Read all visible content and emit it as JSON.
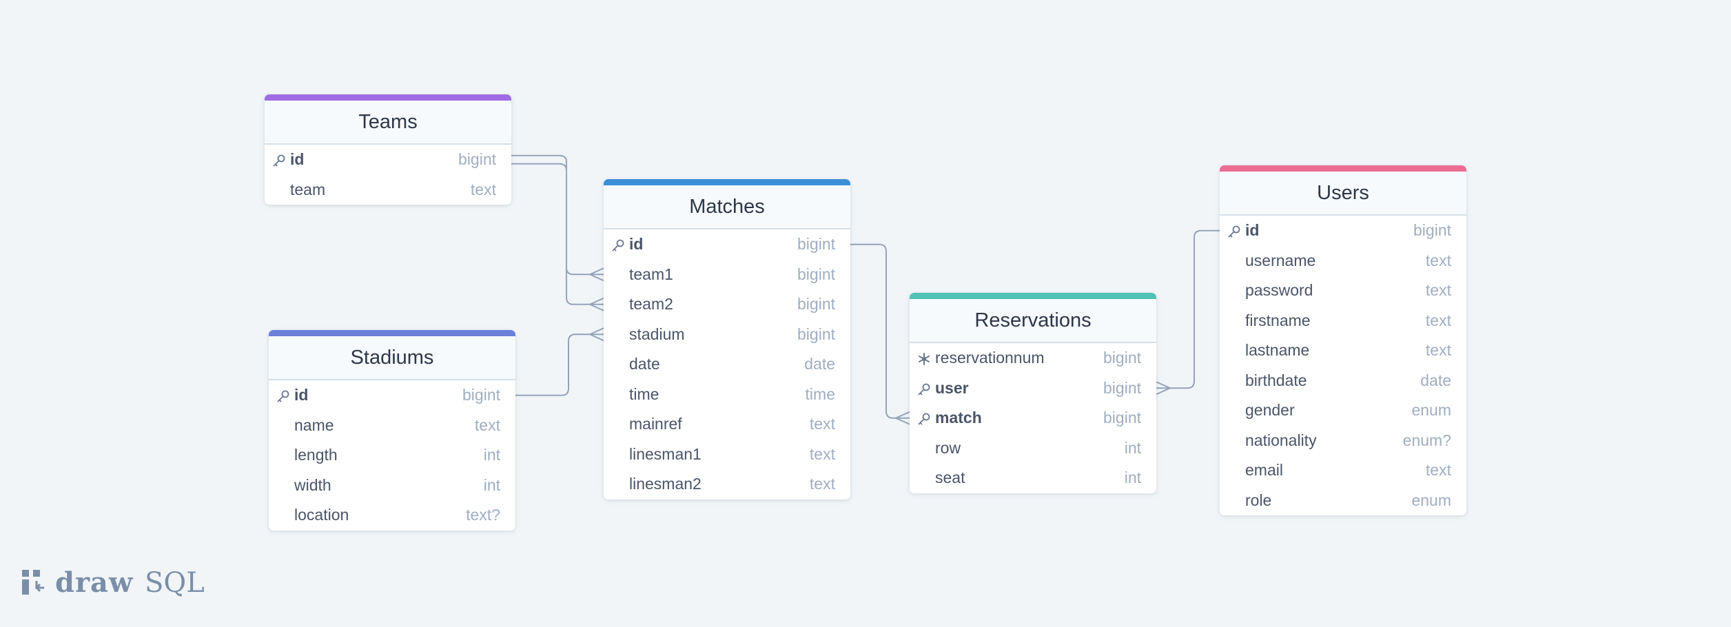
{
  "diagram": {
    "tables": [
      {
        "id": "teams",
        "name": "Teams",
        "accent": "#9f6be3",
        "columns": [
          {
            "name": "id",
            "type": "bigint",
            "key": "primary"
          },
          {
            "name": "team",
            "type": "text",
            "key": "none"
          }
        ]
      },
      {
        "id": "stadiums",
        "name": "Stadiums",
        "accent": "#6b7fd8",
        "columns": [
          {
            "name": "id",
            "type": "bigint",
            "key": "primary"
          },
          {
            "name": "name",
            "type": "text",
            "key": "none"
          },
          {
            "name": "length",
            "type": "int",
            "key": "none"
          },
          {
            "name": "width",
            "type": "int",
            "key": "none"
          },
          {
            "name": "location",
            "type": "text?",
            "key": "none"
          }
        ]
      },
      {
        "id": "matches",
        "name": "Matches",
        "accent": "#3a8fd6",
        "columns": [
          {
            "name": "id",
            "type": "bigint",
            "key": "primary"
          },
          {
            "name": "team1",
            "type": "bigint",
            "key": "none"
          },
          {
            "name": "team2",
            "type": "bigint",
            "key": "none"
          },
          {
            "name": "stadium",
            "type": "bigint",
            "key": "none"
          },
          {
            "name": "date",
            "type": "date",
            "key": "none"
          },
          {
            "name": "time",
            "type": "time",
            "key": "none"
          },
          {
            "name": "mainref",
            "type": "text",
            "key": "none"
          },
          {
            "name": "linesman1",
            "type": "text",
            "key": "none"
          },
          {
            "name": "linesman2",
            "type": "text",
            "key": "none"
          }
        ]
      },
      {
        "id": "reservations",
        "name": "Reservations",
        "accent": "#4fc1b5",
        "columns": [
          {
            "name": "reservationnum",
            "type": "bigint",
            "key": "unique"
          },
          {
            "name": "user",
            "type": "bigint",
            "key": "primary"
          },
          {
            "name": "match",
            "type": "bigint",
            "key": "primary"
          },
          {
            "name": "row",
            "type": "int",
            "key": "none"
          },
          {
            "name": "seat",
            "type": "int",
            "key": "none"
          }
        ]
      },
      {
        "id": "users",
        "name": "Users",
        "accent": "#ec6c93",
        "columns": [
          {
            "name": "id",
            "type": "bigint",
            "key": "primary"
          },
          {
            "name": "username",
            "type": "text",
            "key": "none"
          },
          {
            "name": "password",
            "type": "text",
            "key": "none"
          },
          {
            "name": "firstname",
            "type": "text",
            "key": "none"
          },
          {
            "name": "lastname",
            "type": "text",
            "key": "none"
          },
          {
            "name": "birthdate",
            "type": "date",
            "key": "none"
          },
          {
            "name": "gender",
            "type": "enum",
            "key": "none"
          },
          {
            "name": "nationality",
            "type": "enum?",
            "key": "none"
          },
          {
            "name": "email",
            "type": "text",
            "key": "none"
          },
          {
            "name": "role",
            "type": "enum",
            "key": "none"
          }
        ]
      }
    ],
    "relationships": [
      {
        "from": "teams.id",
        "to": "matches.team1",
        "cardinality": "one-to-many"
      },
      {
        "from": "teams.id",
        "to": "matches.team2",
        "cardinality": "one-to-many"
      },
      {
        "from": "stadiums.id",
        "to": "matches.stadium",
        "cardinality": "one-to-many"
      },
      {
        "from": "matches.id",
        "to": "reservations.match",
        "cardinality": "one-to-many"
      },
      {
        "from": "users.id",
        "to": "reservations.user",
        "cardinality": "one-to-many"
      }
    ],
    "line_color": "#94a3b8",
    "key_icon_color": "#6b7a90"
  },
  "brand": {
    "word_draw": "draw",
    "word_sql": "SQL",
    "icon": "drawsql-logo-icon",
    "color": "#7a8ea8"
  }
}
